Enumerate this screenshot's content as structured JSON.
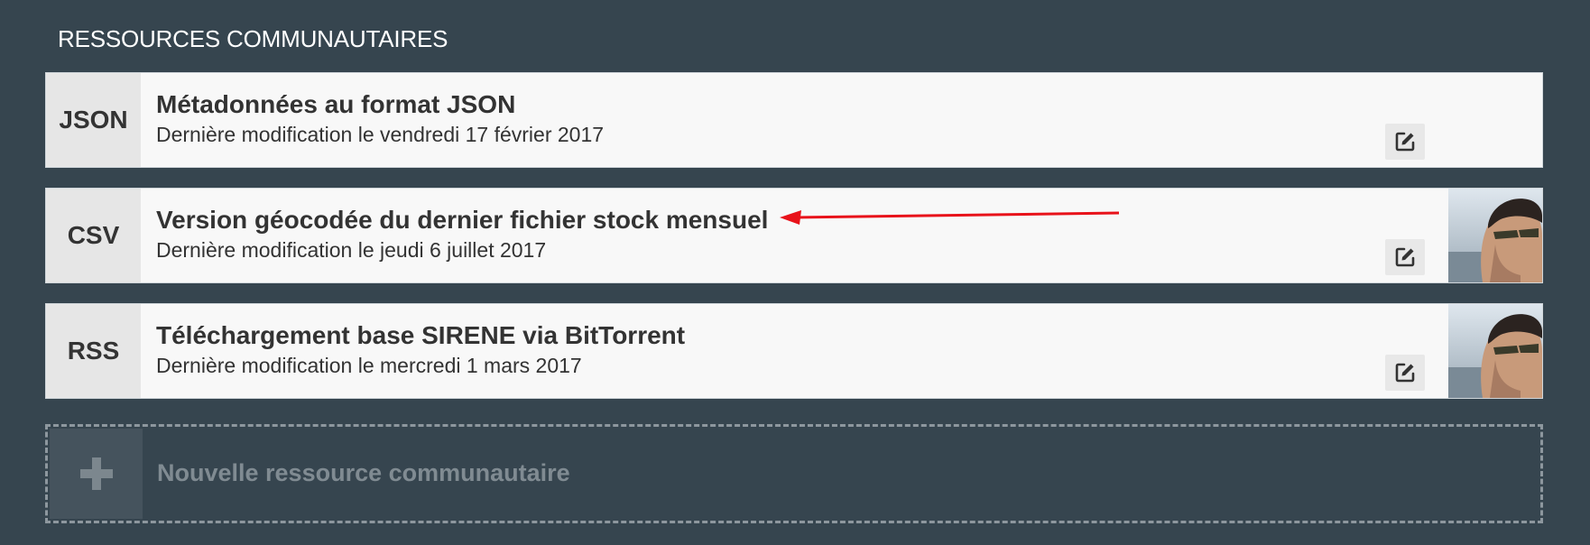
{
  "section": {
    "title": "RESSOURCES COMMUNAUTAIRES"
  },
  "resources": [
    {
      "format": "JSON",
      "title": "Métadonnées au format JSON",
      "subtitle": "Dernière modification le vendredi 17 février 2017",
      "has_avatar": false
    },
    {
      "format": "CSV",
      "title": "Version géocodée du dernier fichier stock mensuel",
      "subtitle": "Dernière modification le jeudi 6 juillet 2017",
      "has_avatar": true
    },
    {
      "format": "RSS",
      "title": "Téléchargement base SIRENE via BitTorrent",
      "subtitle": "Dernière modification le mercredi 1 mars 2017",
      "has_avatar": true
    }
  ],
  "new_resource": {
    "label": "Nouvelle ressource communautaire",
    "icon": "plus-icon"
  },
  "icons": {
    "edit": "edit-icon",
    "annotation": "red-arrow"
  },
  "colors": {
    "background": "#36454f",
    "card": "#f8f8f8",
    "format_box": "#e6e6e6",
    "annotation_arrow": "#e8121a"
  }
}
